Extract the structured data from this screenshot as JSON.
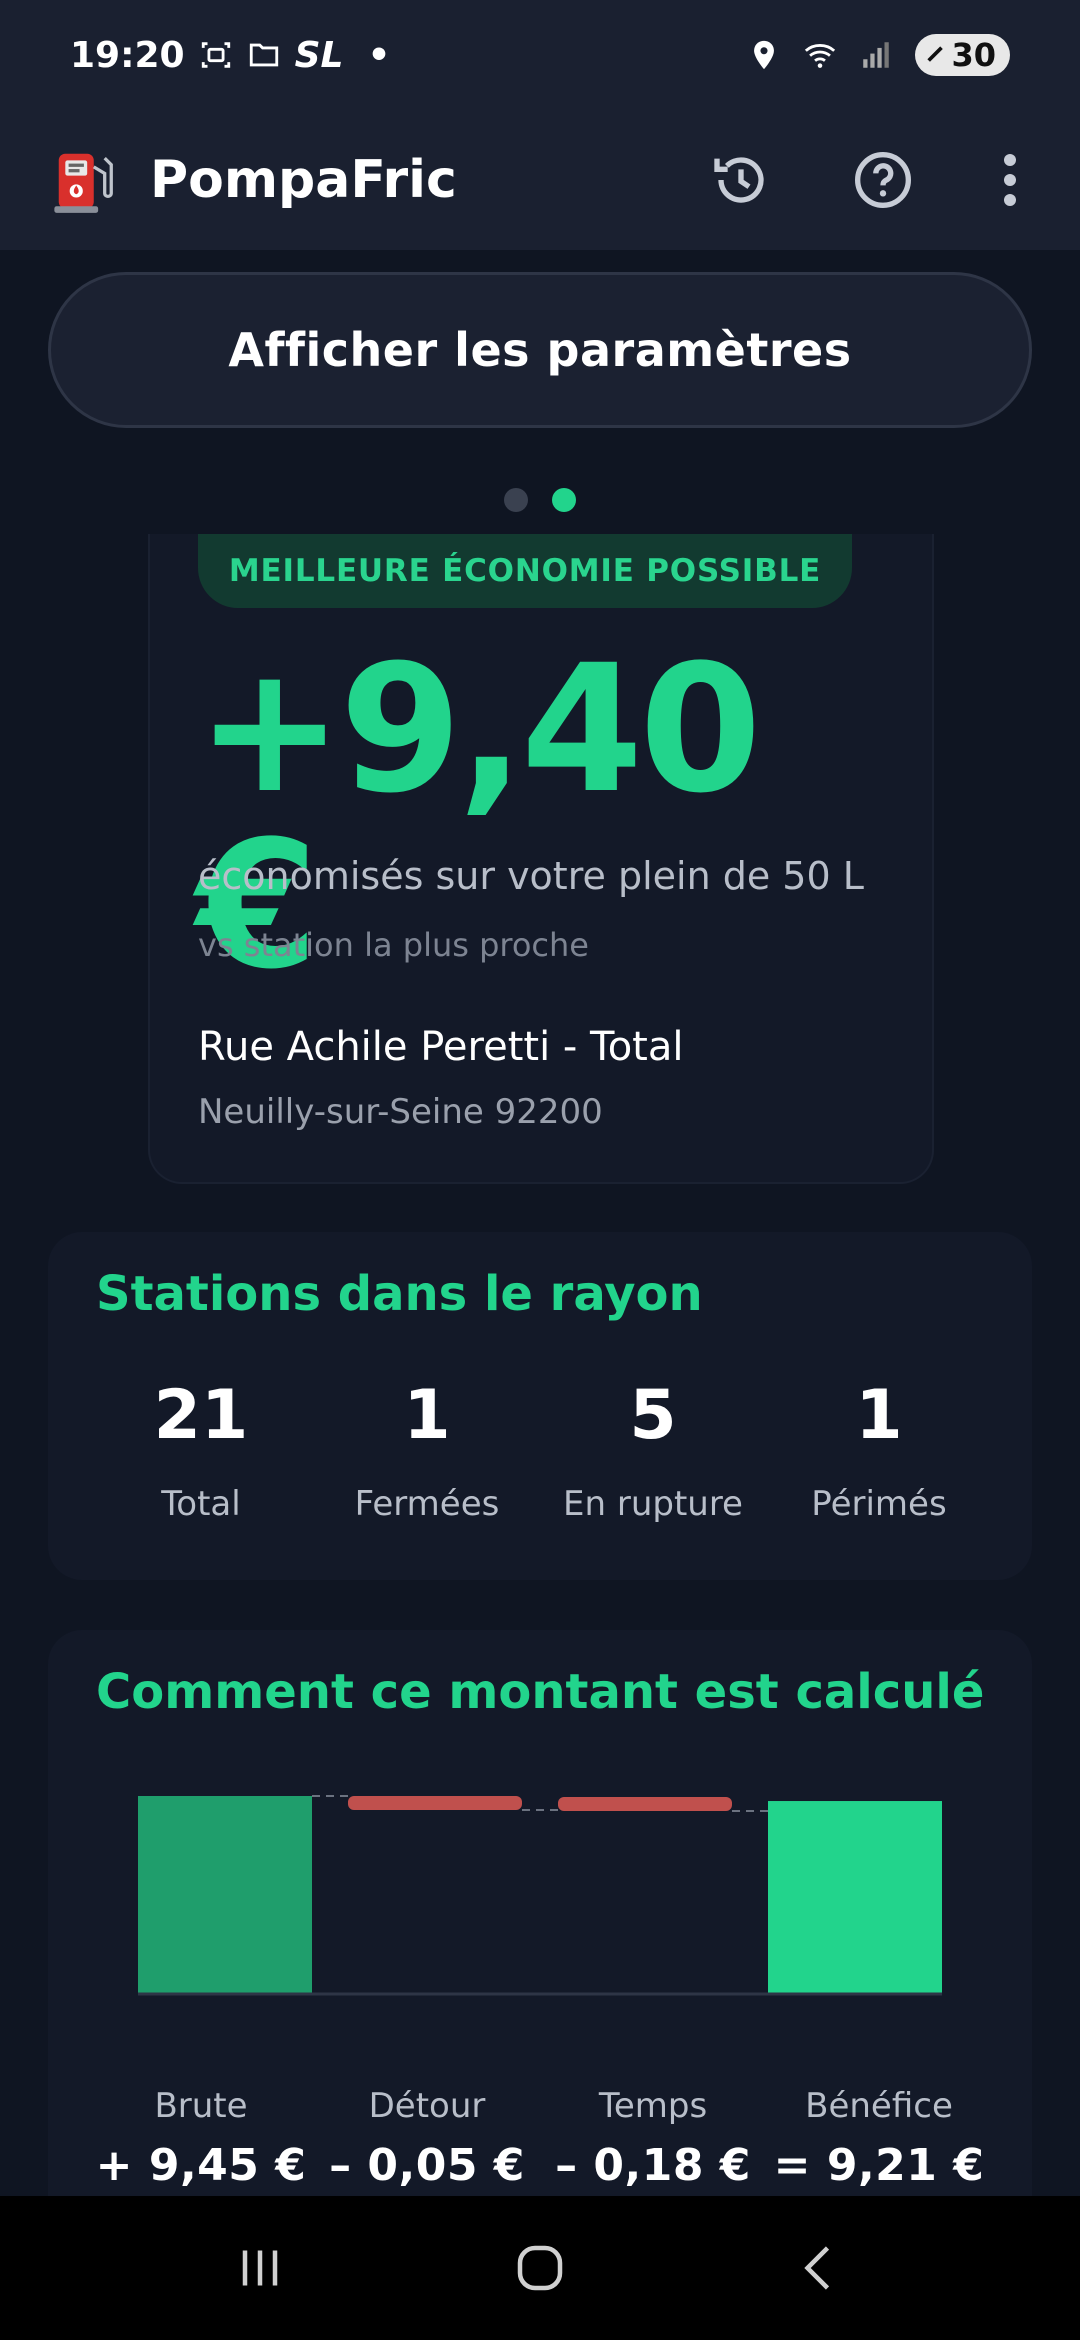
{
  "status_bar": {
    "time": "19:20",
    "carrier": "SL",
    "dot": "•",
    "battery": "30",
    "icons": [
      "screenshot-icon",
      "folder-icon",
      "location-icon",
      "wifi-icon",
      "signal-icon",
      "battery-icon"
    ]
  },
  "app_bar": {
    "title": "PompaFric",
    "logo_icon": "fuel-pump-icon",
    "actions": [
      "history-icon",
      "help-icon",
      "more-vert-icon"
    ]
  },
  "settings_button": {
    "label": "Afficher les paramètres"
  },
  "pager": {
    "count": 2,
    "active_index": 1
  },
  "savings": {
    "badge": "MEILLEURE ÉCONOMIE POSSIBLE",
    "amount": "+9,40 €",
    "description": "économisés sur votre plein de 50 L",
    "comparison": "vs station la plus proche",
    "station_name": "Rue Achile Peretti - Total",
    "station_city": "Neuilly-sur-Seine 92200"
  },
  "stations": {
    "title": "Stations dans le rayon",
    "stats": [
      {
        "value": "21",
        "label": "Total"
      },
      {
        "value": "1",
        "label": "Fermées"
      },
      {
        "value": "5",
        "label": "En rupture"
      },
      {
        "value": "1",
        "label": "Périmés"
      }
    ]
  },
  "calculation": {
    "title": "Comment ce montant est calculé",
    "items": [
      {
        "label": "Brute",
        "value": "+ 9,45 €"
      },
      {
        "label": "Détour",
        "value": "– 0,05 €"
      },
      {
        "label": "Temps",
        "value": "– 0,18 €"
      },
      {
        "label": "Bénéfice",
        "value": "= 9,21 €"
      }
    ]
  },
  "chart_data": {
    "type": "bar",
    "categories": [
      "Brute",
      "Détour",
      "Temps",
      "Bénéfice"
    ],
    "values": [
      9.45,
      -0.05,
      -0.18,
      9.21
    ],
    "colors": [
      "#1f9e6c",
      "#c0504d",
      "#c0504d",
      "#22d48c"
    ]
  },
  "nav_bar": {
    "buttons": [
      "recents-icon",
      "home-icon",
      "back-icon"
    ]
  },
  "colors": {
    "accent": "#22d48c",
    "background": "#0f1522",
    "card": "#131928",
    "negative": "#c0504d"
  }
}
